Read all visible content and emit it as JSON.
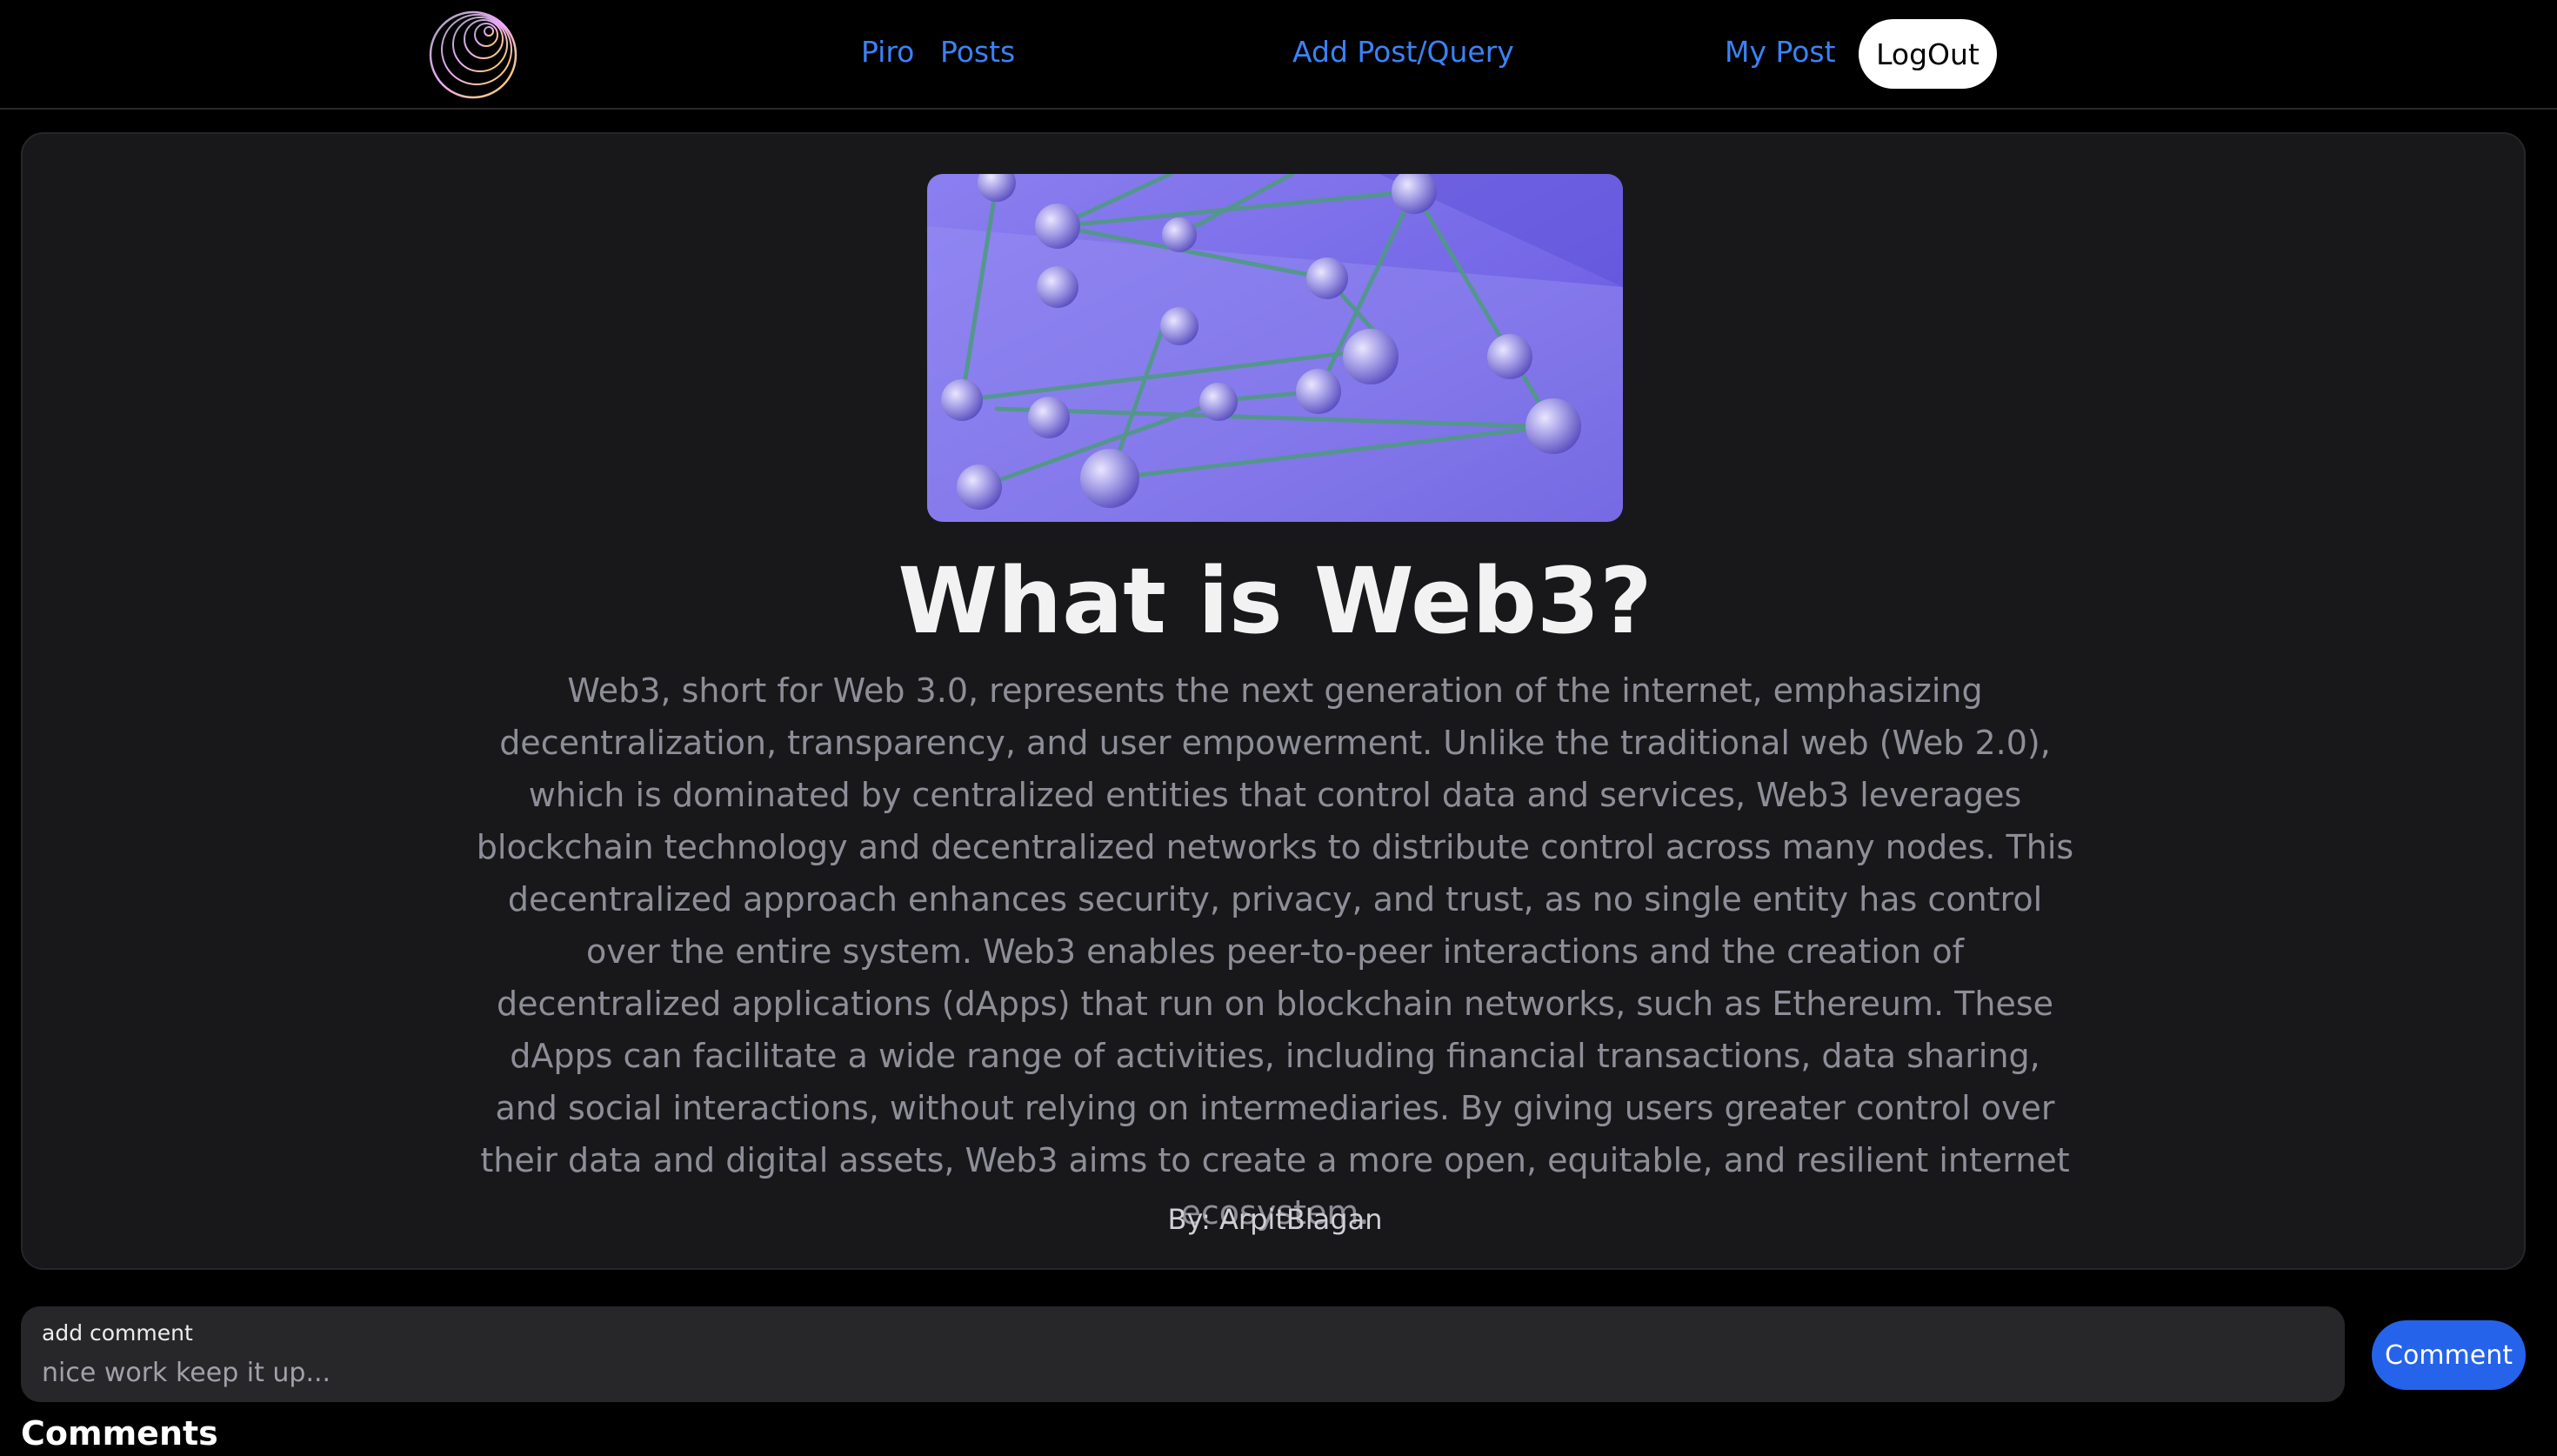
{
  "navbar": {
    "logo_icon": "globe-rings-icon",
    "links": {
      "piro": "Piro",
      "posts": "Posts",
      "add_post": "Add Post/Query",
      "my_post": "My Post"
    },
    "logout_label": "LogOut"
  },
  "post": {
    "image_icon": "network-nodes-illustration",
    "title": "What is Web3?",
    "body": "Web3, short for Web 3.0, represents the next generation of the internet, emphasizing decentralization, transparency, and user empowerment. Unlike the traditional web (Web 2.0), which is dominated by centralized entities that control data and services, Web3 leverages blockchain technology and decentralized networks to distribute control across many nodes. This decentralized approach enhances security, privacy, and trust, as no single entity has control over the entire system. Web3 enables peer-to-peer interactions and the creation of decentralized applications (dApps) that run on blockchain networks, such as Ethereum. These dApps can facilitate a wide range of activities, including financial transactions, data sharing, and social interactions, without relying on intermediaries. By giving users greater control over their data and digital assets, Web3 aims to create a more open, equitable, and resilient internet ecosystem.",
    "author": "By: ArpitBlagan"
  },
  "comment_form": {
    "label": "add comment",
    "placeholder": "nice work keep it up...",
    "value": "",
    "submit_label": "Comment"
  },
  "comments": {
    "heading": "Comments"
  },
  "colors": {
    "accent_link": "#3b82f6",
    "button_primary": "#2563eb",
    "card_bg": "#18181b",
    "page_bg": "#000000"
  }
}
